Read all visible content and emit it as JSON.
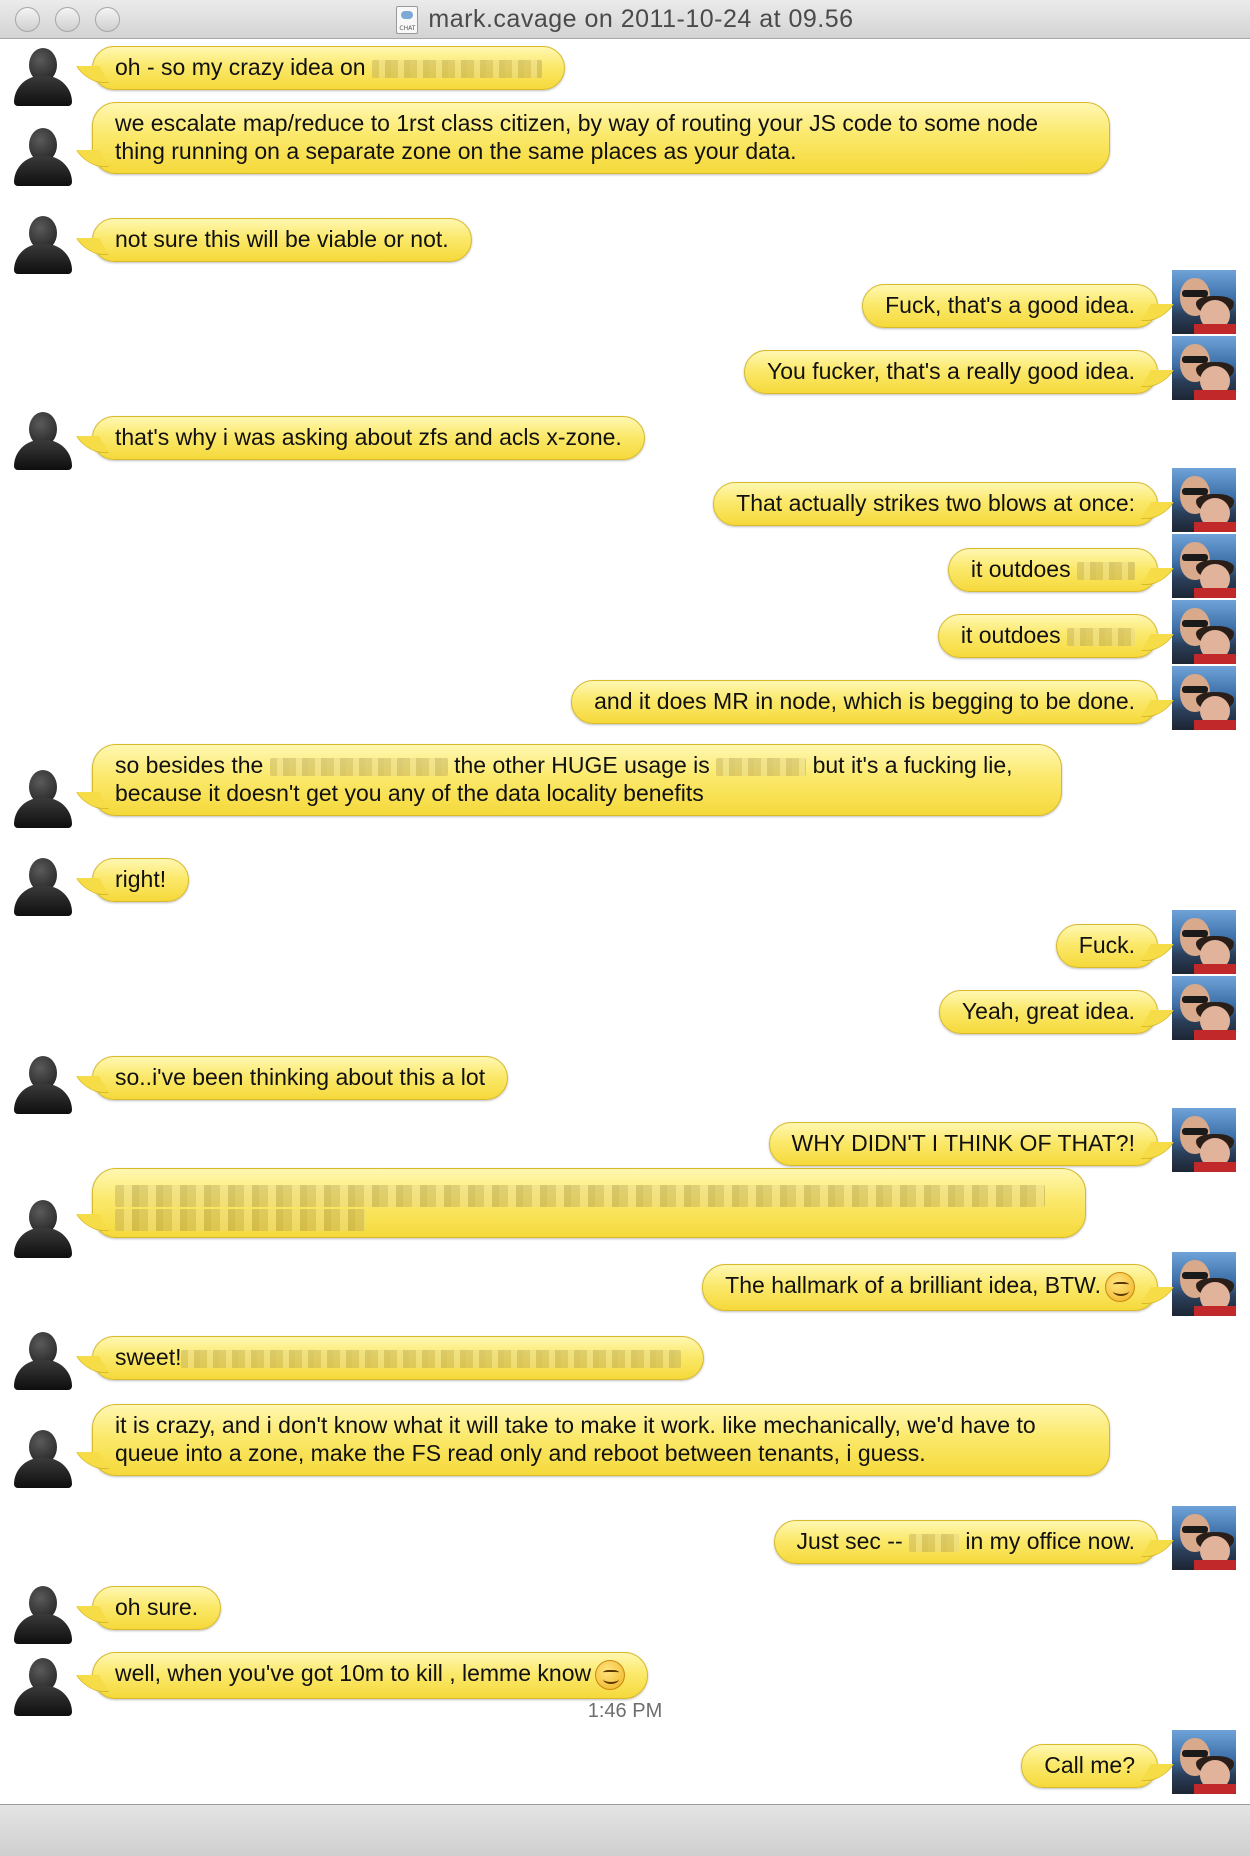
{
  "window": {
    "title": "mark.cavage on 2011-10-24 at 09.56",
    "file_icon_label": "CHAT"
  },
  "messages": [
    {
      "from": "other",
      "parts": [
        "oh - so my crazy idea on ",
        "[redacted]"
      ]
    },
    {
      "from": "other",
      "text": "we escalate map/reduce to 1rst class citizen, by way of routing your JS code to some node thing running on a separate zone on the same places as your data."
    },
    {
      "from": "other",
      "text": "not sure this will be viable or not."
    },
    {
      "from": "me",
      "text": "Fuck, that's a good idea."
    },
    {
      "from": "me",
      "text": "You fucker, that's a really good idea."
    },
    {
      "from": "other",
      "text": "that's why i was asking about zfs and acls x-zone."
    },
    {
      "from": "me",
      "text": "That actually strikes two blows at once:"
    },
    {
      "from": "me",
      "parts": [
        "it outdoes ",
        "[redacted]"
      ]
    },
    {
      "from": "me",
      "parts": [
        "it outdoes ",
        "[redacted]"
      ]
    },
    {
      "from": "me",
      "text": "and it does MR in node, which is begging to be done."
    },
    {
      "from": "other",
      "parts": [
        "so besides the ",
        "[redacted]",
        " the other HUGE usage is ",
        "[redacted]",
        " but it's a fucking lie,",
        "because it doesn't get you any of the data locality benefits"
      ]
    },
    {
      "from": "other",
      "text": "right!"
    },
    {
      "from": "me",
      "text": "Fuck."
    },
    {
      "from": "me",
      "text": "Yeah, great idea."
    },
    {
      "from": "other",
      "text": "so..i've been thinking about this a lot"
    },
    {
      "from": "me",
      "text": "WHY DIDN'T I THINK OF THAT?!"
    },
    {
      "from": "other",
      "text": "[redacted]"
    },
    {
      "from": "me",
      "text": "The hallmark of a brilliant idea, BTW."
    },
    {
      "from": "other",
      "parts": [
        "sweet!",
        "[redacted]"
      ]
    },
    {
      "from": "other",
      "text": "it is crazy, and i don't know what it will take to make it work. like mechanically, we'd have to queue into a zone, make the FS read only and reboot between tenants, i guess."
    },
    {
      "from": "me",
      "parts": [
        "Just sec -- ",
        "[redacted]",
        " in my office now."
      ]
    },
    {
      "from": "other",
      "text": "oh sure."
    },
    {
      "from": "other",
      "text": "well, when you've got 10m to kill , lemme know"
    },
    {
      "from": "me",
      "text": "Call me?"
    }
  ],
  "timestamp": "1:46 PM",
  "icons": {
    "generic_avatar": "person-silhouette-icon",
    "own_avatar": "user-photo-icon",
    "emoticon": "wink-smiley-icon"
  },
  "colors": {
    "bubble": "#f8e256",
    "bubble_border": "#d7b92a",
    "window_bg": "#ffffff"
  }
}
